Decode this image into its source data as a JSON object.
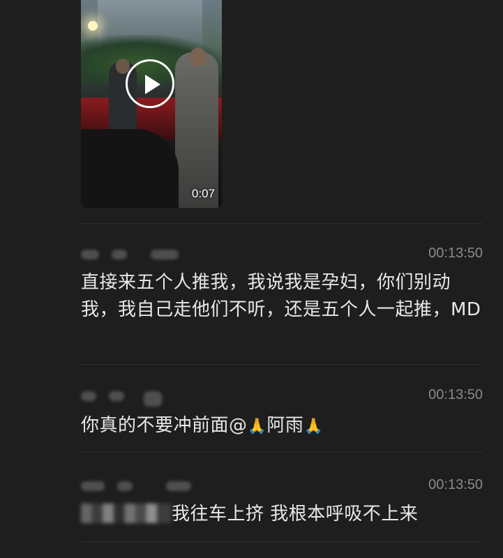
{
  "video": {
    "duration": "0:07",
    "play_icon": "play-icon"
  },
  "messages": [
    {
      "time": "00:13:50",
      "text": "直接来五个人推我，我说我是孕妇，你们别动我，我自己走他们不听，还是五个人一起推，MD"
    },
    {
      "time": "00:13:50",
      "text_before": "你真的不要冲前面@",
      "emoji_1": "🙏",
      "text_middle": "阿雨",
      "emoji_2": "🙏"
    },
    {
      "time": "00:13:50",
      "text_after_mosaic": "我往车上挤 我根本呼吸不上来"
    }
  ]
}
